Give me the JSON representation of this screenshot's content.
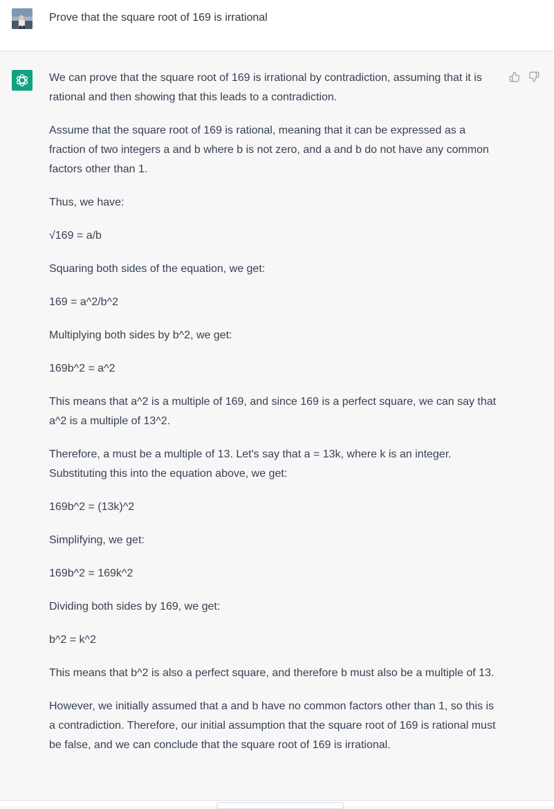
{
  "user_message": {
    "text": "Prove that the square root of 169 is irrational"
  },
  "assistant_message": {
    "paragraphs": [
      "We can prove that the square root of 169 is irrational by contradiction, assuming that it is rational and then showing that this leads to a contradiction.",
      "Assume that the square root of 169 is rational, meaning that it can be expressed as a fraction of two integers a and b where b is not zero, and a and b do not have any common factors other than 1.",
      "Thus, we have:",
      "√169 = a/b",
      "Squaring both sides of the equation, we get:",
      "169 = a^2/b^2",
      "Multiplying both sides by b^2, we get:",
      "169b^2 = a^2",
      "This means that a^2 is a multiple of 169, and since 169 is a perfect square, we can say that a^2 is a multiple of 13^2.",
      "Therefore, a must be a multiple of 13. Let's say that a = 13k, where k is an integer. Substituting this into the equation above, we get:",
      "169b^2 = (13k)^2",
      "Simplifying, we get:",
      "169b^2 = 169k^2",
      "Dividing both sides by 169, we get:",
      "b^2 = k^2",
      "This means that b^2 is also a perfect square, and therefore b must also be a multiple of 13.",
      "However, we initially assumed that a and b have no common factors other than 1, so this is a contradiction. Therefore, our initial assumption that the square root of 169 is rational must be false, and we can conclude that the square root of 169 is irrational."
    ]
  },
  "icons": {
    "user_avatar": "user-avatar-photo",
    "assistant_avatar": "openai-logo-icon",
    "feedback_up": "thumbs-up-icon",
    "feedback_down": "thumbs-down-icon"
  },
  "colors": {
    "assistant_avatar_bg": "#10a37f",
    "user_row_bg": "#ffffff",
    "assistant_row_bg": "#f7f7f8",
    "text": "#374151"
  }
}
